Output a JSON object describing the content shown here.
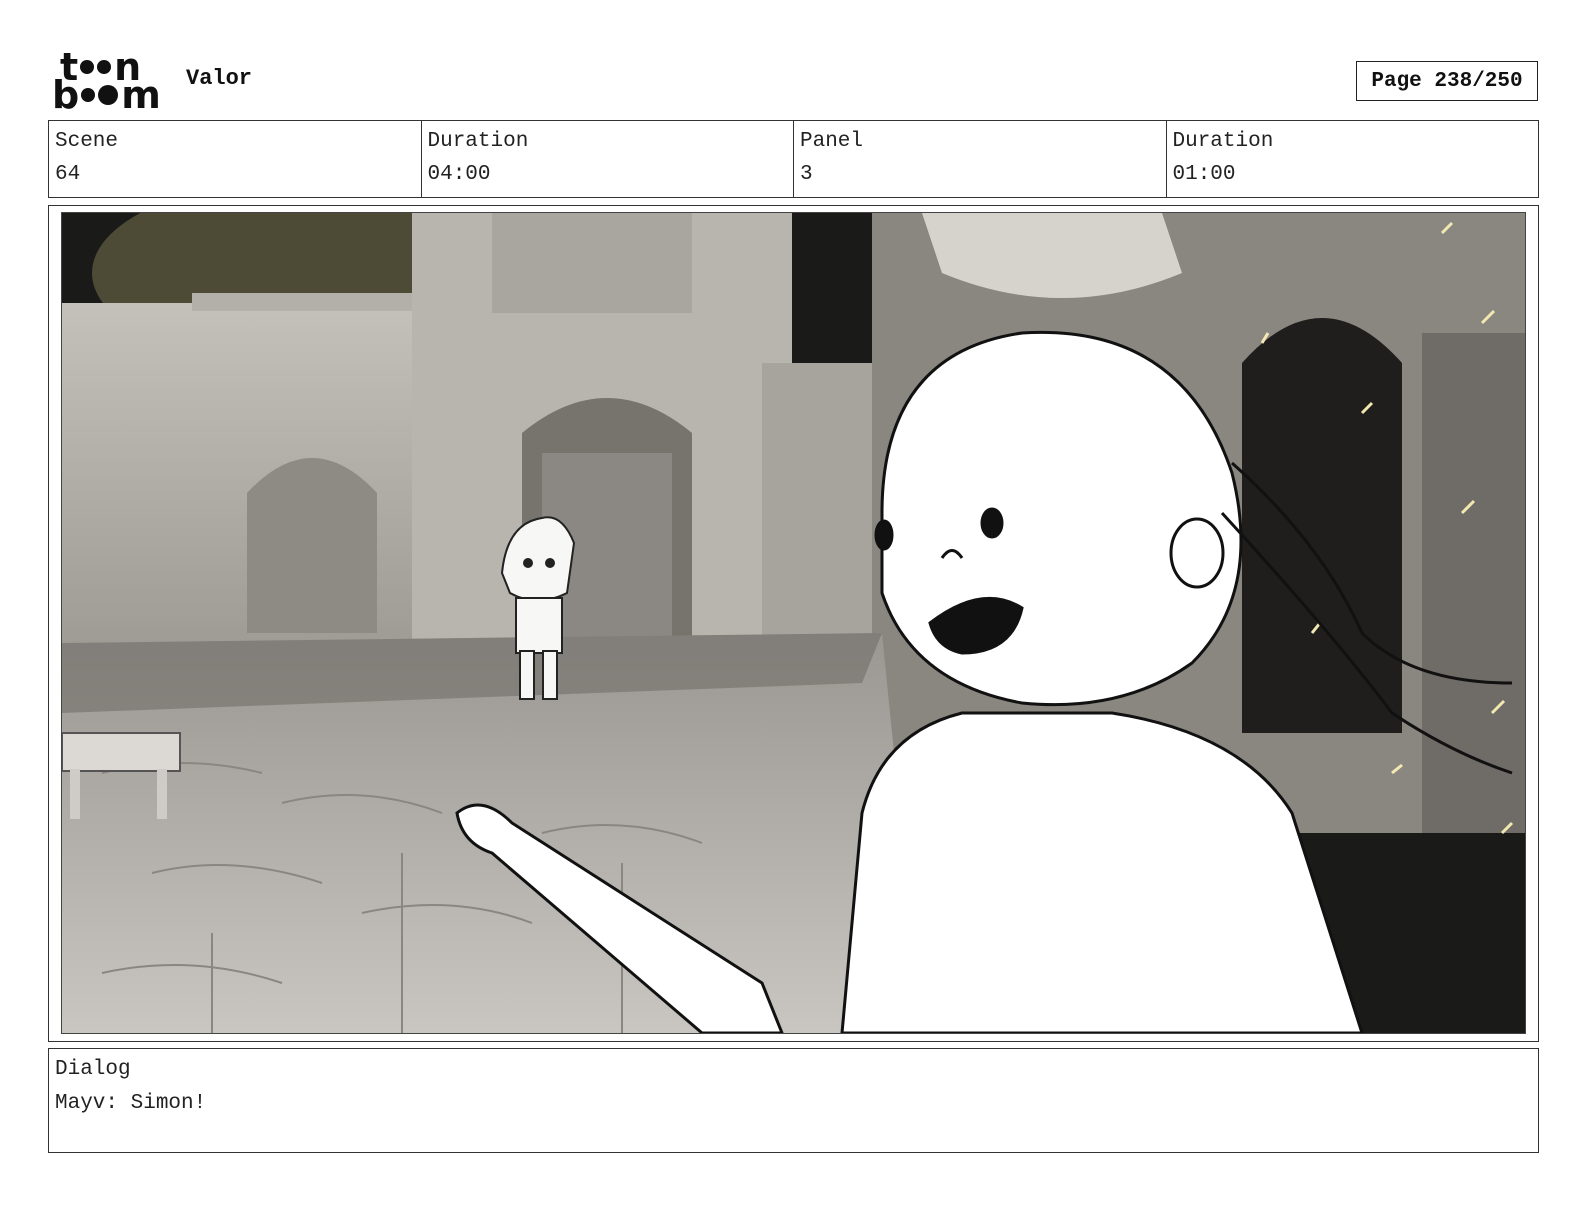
{
  "header": {
    "logo": {
      "line1": [
        "t",
        "n"
      ],
      "line2": [
        "b",
        "m"
      ]
    },
    "project_title": "Valor",
    "page_indicator": "Page 238/250"
  },
  "info": {
    "scene_label": "Scene",
    "scene_value": "64",
    "scene_duration_label": "Duration",
    "scene_duration_value": "04:00",
    "panel_label": "Panel",
    "panel_value": "3",
    "panel_duration_label": "Duration",
    "panel_duration_value": "01:00"
  },
  "dialog": {
    "label": "Dialog",
    "text": "Mayv: Simon!"
  }
}
